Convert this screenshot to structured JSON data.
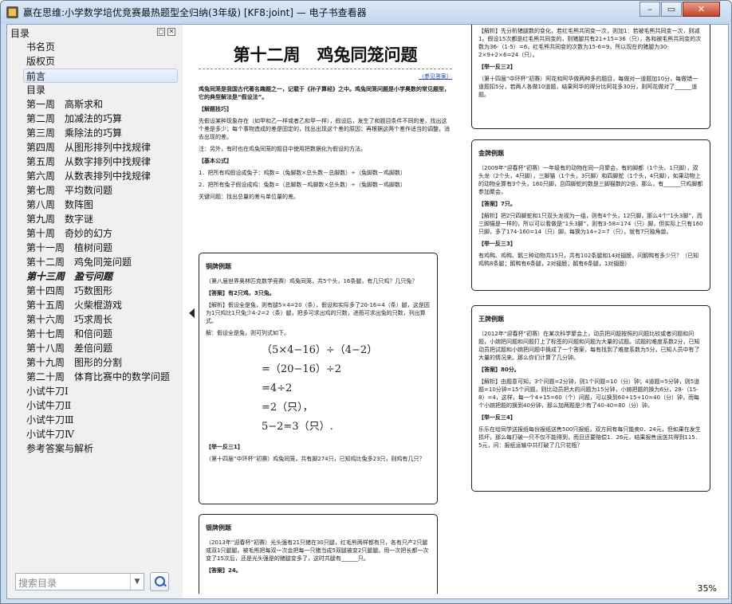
{
  "window": {
    "title": "赢在思维:小学数学培优竞赛最热题型全归纳(3年级) [KF8:joint] — 电子书查看器",
    "min": "–",
    "max": "▭",
    "close": "✕"
  },
  "sidebar": {
    "header": "目录",
    "items": [
      "书名页",
      "版权页",
      "前言",
      "目录",
      "第一周　高斯求和",
      "第二周　加减法的巧算",
      "第三周　乘除法的巧算",
      "第四周　从图形排列中找规律",
      "第五周　从数字排列中找规律",
      "第六周　从数表排列中找规律",
      "第七周　平均数问题",
      "第八周　数阵图",
      "第九周　数字谜",
      "第十周　奇妙的幻方",
      "第十一周　植树问题",
      "第十二周　鸡兔同笼问题",
      "第十三周　盈亏问题",
      "第十四周　巧数图形",
      "第十五周　火柴棍游戏",
      "第十六周　巧求周长",
      "第十七周　和倍问题",
      "第十八周　差倍问题",
      "第十九周　图形的分割",
      "第二十周　体育比赛中的数学问题",
      "小试牛刀Ⅰ",
      "小试牛刀Ⅱ",
      "小试牛刀Ⅲ",
      "小试牛刀Ⅳ",
      "参考答案与解析"
    ],
    "search_placeholder": "搜索目录"
  },
  "page1": {
    "chapter": "第十二周　鸡兔同笼问题",
    "link": "（参见答案）",
    "intro": "鸡兔同笼是我国古代著名趣题之一，记载于《孙子算经》之中。鸡兔同笼问题是小学奥数的常见题型，它的典型解法是“假设法”。",
    "s1": "【解题技巧】",
    "s1p": "先假设某种现象存在（如甲和乙一样或者乙和甲一样），假设后，发生了和题目条件不同的差，找出这个差是多少；每个事物造成的差是固定的，找出出现这个差的原因；再根据这两个差作适当的调整，消去出现的差。",
    "s1n": "注：另外，有时也在鸡兔同笼的题目中使用把数据化为假设的方法。",
    "s2": "【基本公式】",
    "f1": "1．把所有鸡假设成兔子：鸡数=（兔脚数×总头数－总脚数）÷（兔脚数－鸡脚数）",
    "f2": "2．把所有兔子假设成鸡：兔数=（总脚数－鸡脚数×总头数）÷（兔脚数－鸡脚数）",
    "key": "关键问题：找出总量的差与单位量的差。",
    "ex1_title": "铜牌例题",
    "ex1_q": "（第八届世界奥林匹克数学竞赛）鸡兔同笼，共5个头，16条腿，有几只鸡？几只兔？",
    "ex1_a": "【答案】有2只鸡，3只兔。",
    "ex1_s": "【解析】假设全是兔，则有腿5×4=20（条），假设和实际多了20-16=4（条）腿，这是因为1只鸡比1只兔少4-2=2（条）腿，把多可求出鸡的只数，进而可求出兔的只数，列出算式。",
    "ex1_s2": "解：假设全是兔，则可列式如下。",
    "m1": "（5×4−16）÷（4−2）",
    "m2": "=（20−16）÷2",
    "m3": "=4÷2",
    "m4": "=2（只），",
    "m5": "5−2=3（只）.",
    "ex1_t": "【举一反三1】",
    "ex1_t1": "（第十四届“中环杯”初赛）鸡兔同笼，共有脚274只，已知鸡比兔多23只，则鸡有几只？",
    "ex2_title": "银牌例题",
    "ex2_q": "（2013年“迎春杯”初赛）光头强有21只猪在30只腿，红毛熊两样都有只，各有只产2只腿或双1只腿腿。被毛熊把每双一次会把每一只猪当成5双腿被变2只腿腿。用一次把长都一次变了15次后，还是光头强是的猪腿变多了，这时共腿有______只。",
    "ex2_a": "【答案】24。"
  },
  "page2": {
    "p0": "【解析】先分析猪腿数的变化，若红毛熊共同变一次，则加1：若被毛熊共同变一次，则减1。假设15次都是红毛熊共同变的，则猪腿共有21+15=36（只），各和被毛熊共同变的次数为36-（1-5）=6，红毛熊共同变的次数为15-6=9，所以现在的猪腿为30-2×9+2×6=24（只）。",
    "t2": "【举一反三2】",
    "t2p": "（第十四届“中环杯”初赛）阿花和阿华做两种多的题目，每做对一道题加10分，每做错一道题扣5分，若两人各做10道题，结果阿华的得分比阿花多30分，则阿花做对了______道题。",
    "gold": "金牌例题",
    "gq": "（2009年“迎春杯”初赛）一年级有的动物在同一月聚会，有的脚都（1个头、1只脚），双头龙（2个头，4只脚），三脚猫（1个头，3只脚）和四脚蛇（1个头，4只脚），如果动物上的动物全算有3个头，160只脚，且四脚蛇的数是三脚猫数的2倍，那么，有______只鸡脚都参加聚会。",
    "ga": "【答案】7只。",
    "gs": "【解析】把2只四脚蛇和1只双头龙视为一组，则有4个头，12只脚，那么4个“1头3脚”，而三脚猫是一样的，所以可以看做是“1头3脚”，则有3-58=174（只）脚，但实际上只有160只脚，多了174-160=14（只）脚，每换为14÷2=7（只），就有7只独角兽。",
    "t3": "【举一反三3】",
    "t3p": "有鸡鸭、鸡鸭、鹅三种动物共15只，共有102条腿和14对翅膀，问鹅鸭有多少只？（已知鸡鸭8条腿；鹅鸭有6条腿，2对翅膀；鹅有6条腿，1对翅膀）",
    "king": "王牌例题",
    "kq": "（2012年“迎春杯”初赛）在某次科学聚会上，动员把问题按照的问题比较或者问题和问题，小婉把问题和问题打上了标签的问题和问题为大量的试题。试题的难度系数2分，已知动员把试题和小婉把问题中换成了一个答案，每有找到了难度系数为5分，已知人员中有了大量的情况来。那么你们计算了几分钟。",
    "ka": "【答案】80分。",
    "ks": "【解析】由题意可知，3个问题=2分钟，则1个问题=10（分）钟；4道题=5分钟，则5道题=10分钟=15个问题，则比动员把大的问题为15分钟，小婉把题的换为6分，28-（15-8）=4，这样，每一个4+15=60（个）问题，可以换到60+15+10=40（分）钟，而每个小婉把题的换到40分钟，那么加两题是少有了40-40=80（分）钟。",
    "t4": "【举一反三4】",
    "t4p": "乐乐在给同学送报纸每份报纸送售500只报纸，双方同有每只能卖0．24元，但如果在发生损坏，那么每打破一只不仅不能得到，而且还要赔偿1．26元，结果报售运送共得到115．5元，问：报纸运输中共打破了几只花瓶？"
  },
  "zoom": "35%"
}
